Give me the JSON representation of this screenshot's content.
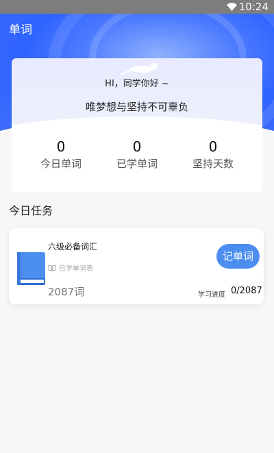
{
  "status_bar": {
    "time": "10:24",
    "wifi_icon": "wifi-icon"
  },
  "header": {
    "title": "单词"
  },
  "summary": {
    "greeting": "HI，同学你好 ~",
    "motto": "唯梦想与坚持不可辜负",
    "stats": [
      {
        "value": "0",
        "label": "今日单词"
      },
      {
        "value": "0",
        "label": "已学单词"
      },
      {
        "value": "0",
        "label": "坚持天数"
      }
    ]
  },
  "tasks": {
    "section_title": "今日任务",
    "book": {
      "icon": "book-icon",
      "title": "六级必备词汇",
      "learned_link": "已学单词表",
      "word_count": "2087词",
      "button_label": "记单词",
      "progress_label": "学习进度",
      "progress_value": "0/2087"
    }
  },
  "colors": {
    "accent": "#4c8df0",
    "hero": "#3f6dfb"
  }
}
